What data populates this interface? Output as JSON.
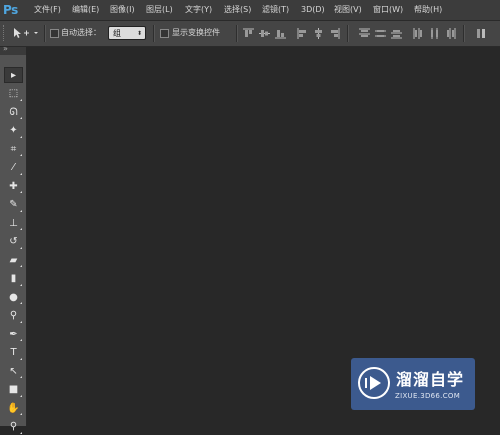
{
  "app": {
    "logo": "Ps"
  },
  "menu": [
    {
      "label": "文件(F)"
    },
    {
      "label": "编辑(E)"
    },
    {
      "label": "图像(I)"
    },
    {
      "label": "图层(L)"
    },
    {
      "label": "文字(Y)"
    },
    {
      "label": "选择(S)"
    },
    {
      "label": "滤镜(T)"
    },
    {
      "label": "3D(D)"
    },
    {
      "label": "视图(V)"
    },
    {
      "label": "窗口(W)"
    },
    {
      "label": "帮助(H)"
    }
  ],
  "options": {
    "auto_select_label": "自动选择：",
    "auto_select_checked": false,
    "auto_select_value": "组",
    "show_transform_label": "显示变换控件",
    "show_transform_checked": false
  },
  "tools": [
    {
      "name": "move-tool-icon",
      "glyph": "▸",
      "active": true
    },
    {
      "name": "marquee-tool-icon",
      "glyph": "⬚"
    },
    {
      "name": "lasso-tool-icon",
      "glyph": "ᘏ"
    },
    {
      "name": "magic-wand-tool-icon",
      "glyph": "✦"
    },
    {
      "name": "crop-tool-icon",
      "glyph": "⌗"
    },
    {
      "name": "eyedropper-tool-icon",
      "glyph": "⁄"
    },
    {
      "name": "healing-brush-tool-icon",
      "glyph": "✚"
    },
    {
      "name": "brush-tool-icon",
      "glyph": "✎"
    },
    {
      "name": "clone-stamp-tool-icon",
      "glyph": "⊥"
    },
    {
      "name": "history-brush-tool-icon",
      "glyph": "↺"
    },
    {
      "name": "eraser-tool-icon",
      "glyph": "▰"
    },
    {
      "name": "gradient-tool-icon",
      "glyph": "▮"
    },
    {
      "name": "blur-tool-icon",
      "glyph": "●"
    },
    {
      "name": "dodge-tool-icon",
      "glyph": "⚲"
    },
    {
      "name": "pen-tool-icon",
      "glyph": "✒"
    },
    {
      "name": "type-tool-icon",
      "glyph": "T"
    },
    {
      "name": "path-selection-tool-icon",
      "glyph": "↖"
    },
    {
      "name": "shape-tool-icon",
      "glyph": "■"
    },
    {
      "name": "hand-tool-icon",
      "glyph": "✋"
    },
    {
      "name": "zoom-tool-icon",
      "glyph": "⚲"
    }
  ],
  "watermark": {
    "title": "溜溜自学",
    "subtitle": "ZIXUE.3D66.COM"
  },
  "colors": {
    "workspace": "#282828",
    "menubar": "#3c3c3c",
    "optionsbar": "#454545",
    "toolbar": "#535353",
    "ps_logo": "#4fa6e0",
    "watermark_bg": "#3c5a8e"
  }
}
